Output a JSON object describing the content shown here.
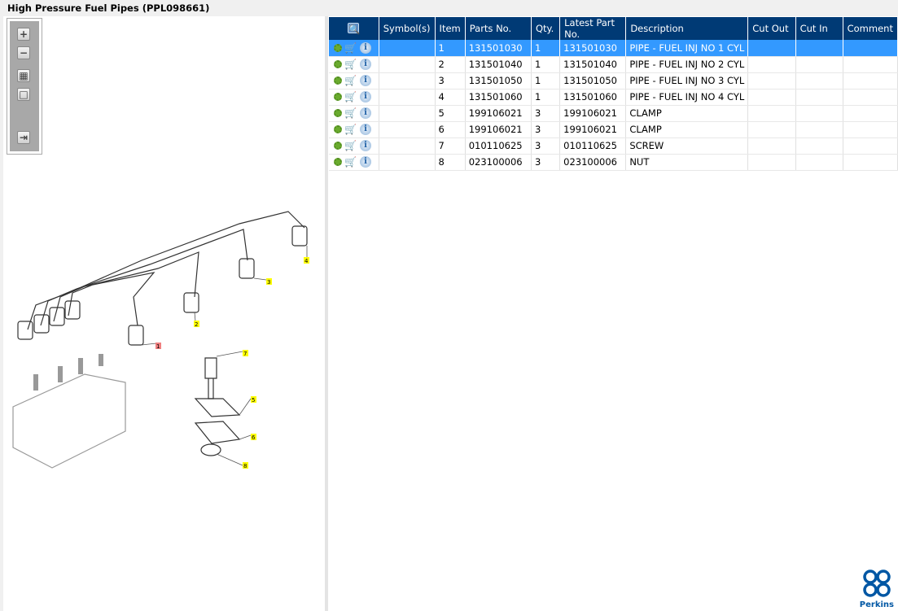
{
  "title": "High Pressure Fuel Pipes (PPL098661)",
  "toolbar": {
    "zoom_in": "+",
    "zoom_out": "−",
    "fit_all": "▦",
    "fit_window": "□",
    "export": "⇥"
  },
  "diagram": {
    "callouts": [
      {
        "label": "1",
        "highlight": "#f08080"
      },
      {
        "label": "2",
        "highlight": "#ffff00"
      },
      {
        "label": "3",
        "highlight": "#ffff00"
      },
      {
        "label": "4",
        "highlight": "#ffff00"
      },
      {
        "label": "5",
        "highlight": "#ffff00"
      },
      {
        "label": "6",
        "highlight": "#ffff00"
      },
      {
        "label": "7",
        "highlight": "#ffff00"
      },
      {
        "label": "8",
        "highlight": "#ffff00"
      }
    ]
  },
  "table": {
    "columns": [
      "",
      "Symbol(s)",
      "Item",
      "Parts No.",
      "Qty.",
      "Latest Part No.",
      "Description",
      "Cut Out",
      "Cut In",
      "Comment"
    ],
    "selected_row": 0,
    "rows": [
      {
        "item": "1",
        "part": "131501030",
        "qty": "1",
        "latest": "131501030",
        "desc": "PIPE - FUEL INJ NO 1 CYL"
      },
      {
        "item": "2",
        "part": "131501040",
        "qty": "1",
        "latest": "131501040",
        "desc": "PIPE - FUEL INJ NO 2 CYL"
      },
      {
        "item": "3",
        "part": "131501050",
        "qty": "1",
        "latest": "131501050",
        "desc": "PIPE - FUEL INJ NO 3 CYL"
      },
      {
        "item": "4",
        "part": "131501060",
        "qty": "1",
        "latest": "131501060",
        "desc": "PIPE - FUEL INJ NO 4 CYL"
      },
      {
        "item": "5",
        "part": "199106021",
        "qty": "3",
        "latest": "199106021",
        "desc": "CLAMP"
      },
      {
        "item": "6",
        "part": "199106021",
        "qty": "3",
        "latest": "199106021",
        "desc": "CLAMP"
      },
      {
        "item": "7",
        "part": "010110625",
        "qty": "3",
        "latest": "010110625",
        "desc": "SCREW"
      },
      {
        "item": "8",
        "part": "023100006",
        "qty": "3",
        "latest": "023100006",
        "desc": "NUT"
      }
    ]
  },
  "logo": {
    "text": "Perkins",
    "color": "#0057a4"
  },
  "colors": {
    "header": "#003a75",
    "selected": "#3399ff"
  }
}
